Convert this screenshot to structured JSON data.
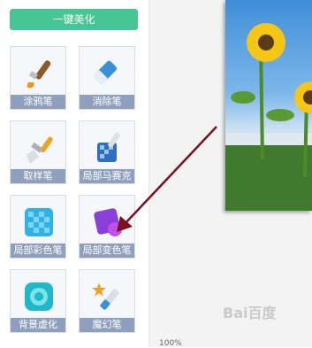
{
  "sidebar": {
    "beautify_label": "一键美化",
    "tools": [
      {
        "label": "涂鸦笔",
        "icon": "brush-icon"
      },
      {
        "label": "消除笔",
        "icon": "eraser-icon"
      },
      {
        "label": "取样笔",
        "icon": "paintbrush-icon"
      },
      {
        "label": "局部马赛克",
        "icon": "mosaic-brush-icon"
      },
      {
        "label": "局部彩色笔",
        "icon": "color-grid-icon"
      },
      {
        "label": "局部变色笔",
        "icon": "color-change-icon"
      },
      {
        "label": "背景虚化",
        "icon": "blur-icon"
      },
      {
        "label": "魔幻笔",
        "icon": "magic-wand-icon"
      }
    ]
  },
  "status": {
    "zoom": "100%"
  },
  "watermark": "Bai百度",
  "colors": {
    "accent": "#46c694",
    "label_bg": "#8fa0bf",
    "arrow": "#7a1020"
  }
}
